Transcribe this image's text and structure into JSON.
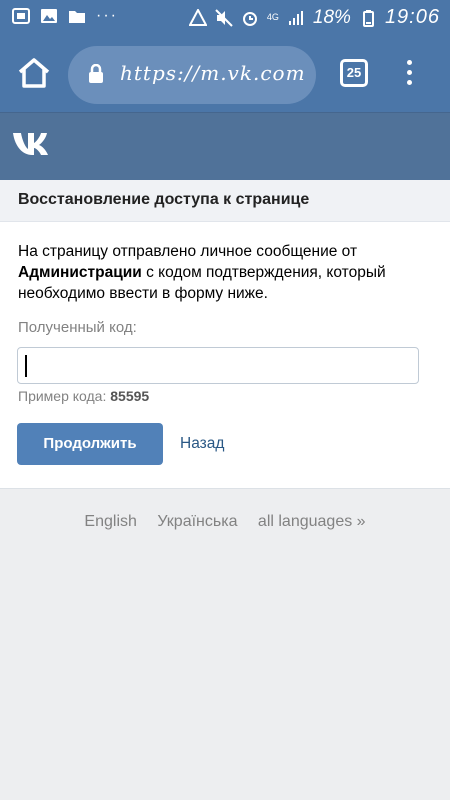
{
  "statusbar": {
    "dots": "···",
    "signal_label": "4G",
    "battery_pct": "18%",
    "time": "19:06"
  },
  "browser": {
    "url": "https://m.vk.com",
    "tabs_count": "25"
  },
  "card": {
    "title": "Восстановление доступа к странице",
    "message_part1": "На страницу отправлено личное сообщение от ",
    "message_bold": "Администрации",
    "message_part2": " с кодом подтверждения, который необходимо ввести в форму ниже.",
    "code_label": "Полученный код:",
    "code_value": "",
    "example_label": "Пример кода: ",
    "example_code": "85595",
    "continue_label": "Продолжить",
    "back_label": "Назад"
  },
  "languages": [
    "English",
    "Українська",
    "all languages »"
  ],
  "colors": {
    "status_bar": "#4b76a8",
    "vk_header": "#507299",
    "button": "#5181b8",
    "link": "#2a5885"
  }
}
